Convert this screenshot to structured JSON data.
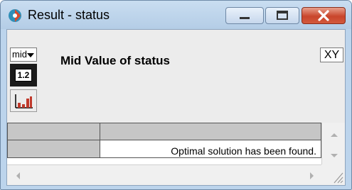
{
  "window": {
    "title": "Result - status",
    "controls": {
      "minimize": "minimize",
      "maximize": "maximize",
      "close": "close"
    }
  },
  "toolbar": {
    "mid_dropdown": "mid",
    "table_view_label": "1.2",
    "graph_view": "chart-icon",
    "xy_label": "XY"
  },
  "heading": "Mid Value of status",
  "table": {
    "status_message": "Optimal solution has been found."
  },
  "colors": {
    "title_bar": "#c9ddf1",
    "close_button": "#c9452b",
    "header_cells": "#c6c6c6"
  }
}
